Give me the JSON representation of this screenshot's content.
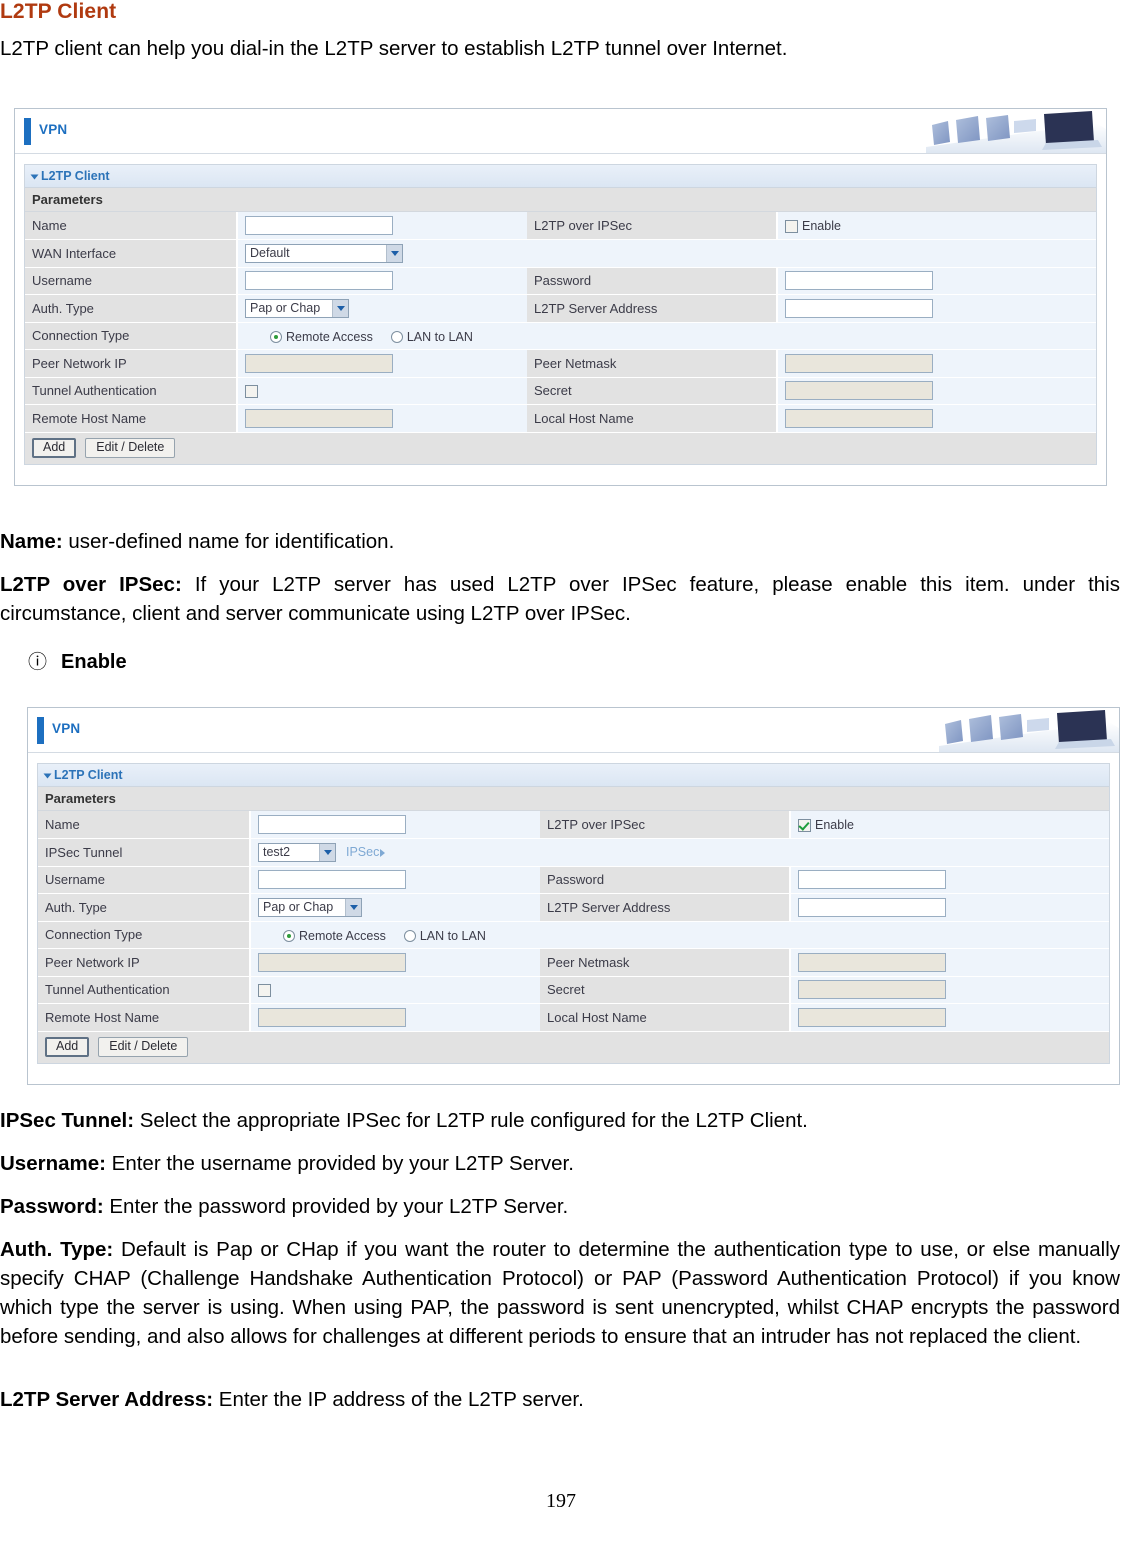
{
  "document": {
    "title": "L2TP Client",
    "intro": "L2TP client can help you dial-in the L2TP server to establish L2TP tunnel over Internet.",
    "page_number": "197",
    "title_color": "#b03a10"
  },
  "descriptions": {
    "name": {
      "term": "Name:",
      "text": " user-defined name for identification."
    },
    "l2tp_over_ipsec": {
      "term": "L2TP over IPSec:",
      "text": " If your L2TP server has used L2TP over IPSec feature, please enable this item. under this circumstance, client and server communicate using L2TP over IPSec."
    },
    "enable_bullet": {
      "glyph": "ⓘ",
      "label": "Enable"
    },
    "ipsec_tunnel": {
      "term": "IPSec Tunnel:",
      "text": " Select the appropriate IPSec for L2TP rule configured for the L2TP Client."
    },
    "username": {
      "term": "Username:",
      "text": " Enter the username provided by your L2TP Server."
    },
    "password": {
      "term": "Password:",
      "text": " Enter the password provided by your L2TP Server."
    },
    "auth_type": {
      "term": "Auth. Type:",
      "text": " Default is Pap or CHap if you want the router to determine the authentication type to use, or else manually specify CHAP (Challenge Handshake Authentication Protocol) or PAP (Password Authentication Protocol) if you know which type the server is using. When using PAP, the password is sent unencrypted, whilst CHAP encrypts the password before sending, and also allows for challenges at different periods to ensure that an intruder has not replaced the client."
    },
    "l2tp_server_address": {
      "term": "L2TP Server Address:",
      "text": " Enter the IP address of the L2TP server."
    }
  },
  "screenshot_one": {
    "header": {
      "title": "VPN",
      "accent_color": "#1d6fc0"
    },
    "section_title": "L2TP Client",
    "params_title": "Parameters",
    "rows": [
      {
        "left_label": "Name",
        "right_label": "L2TP over IPSec"
      },
      {
        "left_label": "WAN Interface",
        "right_label": ""
      },
      {
        "left_label": "Username",
        "right_label": "Password"
      },
      {
        "left_label": "Auth. Type",
        "right_label": "L2TP Server Address"
      },
      {
        "left_label": "Connection Type",
        "right_label": ""
      },
      {
        "left_label": "Peer Network IP",
        "right_label": "Peer Netmask"
      },
      {
        "left_label": "Tunnel Authentication",
        "right_label": "Secret"
      },
      {
        "left_label": "Remote Host Name",
        "right_label": "Local Host Name"
      }
    ],
    "values": {
      "wan_interface": "Default",
      "auth_type": "Pap or Chap",
      "ipsec_enable_label": "Enable",
      "ipsec_enable_checked": false,
      "connection_type_remote_label": "Remote Access",
      "connection_type_lan_label": "LAN to LAN",
      "connection_type_selected": "Remote Access",
      "tunnel_auth_checked": false
    },
    "buttons": {
      "add": "Add",
      "edit_delete": "Edit / Delete"
    }
  },
  "screenshot_two": {
    "header": {
      "title": "VPN",
      "accent_color": "#1d6fc0"
    },
    "section_title": "L2TP Client",
    "params_title": "Parameters",
    "rows": [
      {
        "left_label": "Name",
        "right_label": "L2TP over IPSec"
      },
      {
        "left_label": "IPSec Tunnel",
        "right_label": ""
      },
      {
        "left_label": "Username",
        "right_label": "Password"
      },
      {
        "left_label": "Auth. Type",
        "right_label": "L2TP Server Address"
      },
      {
        "left_label": "Connection Type",
        "right_label": ""
      },
      {
        "left_label": "Peer Network IP",
        "right_label": "Peer Netmask"
      },
      {
        "left_label": "Tunnel Authentication",
        "right_label": "Secret"
      },
      {
        "left_label": "Remote Host Name",
        "right_label": "Local Host Name"
      }
    ],
    "values": {
      "ipsec_tunnel": "test2",
      "ipsec_link": "IPSec",
      "auth_type": "Pap or Chap",
      "ipsec_enable_label": "Enable",
      "ipsec_enable_checked": true,
      "connection_type_remote_label": "Remote Access",
      "connection_type_lan_label": "LAN to LAN",
      "connection_type_selected": "Remote Access",
      "tunnel_auth_checked": false
    },
    "buttons": {
      "add": "Add",
      "edit_delete": "Edit / Delete"
    }
  }
}
